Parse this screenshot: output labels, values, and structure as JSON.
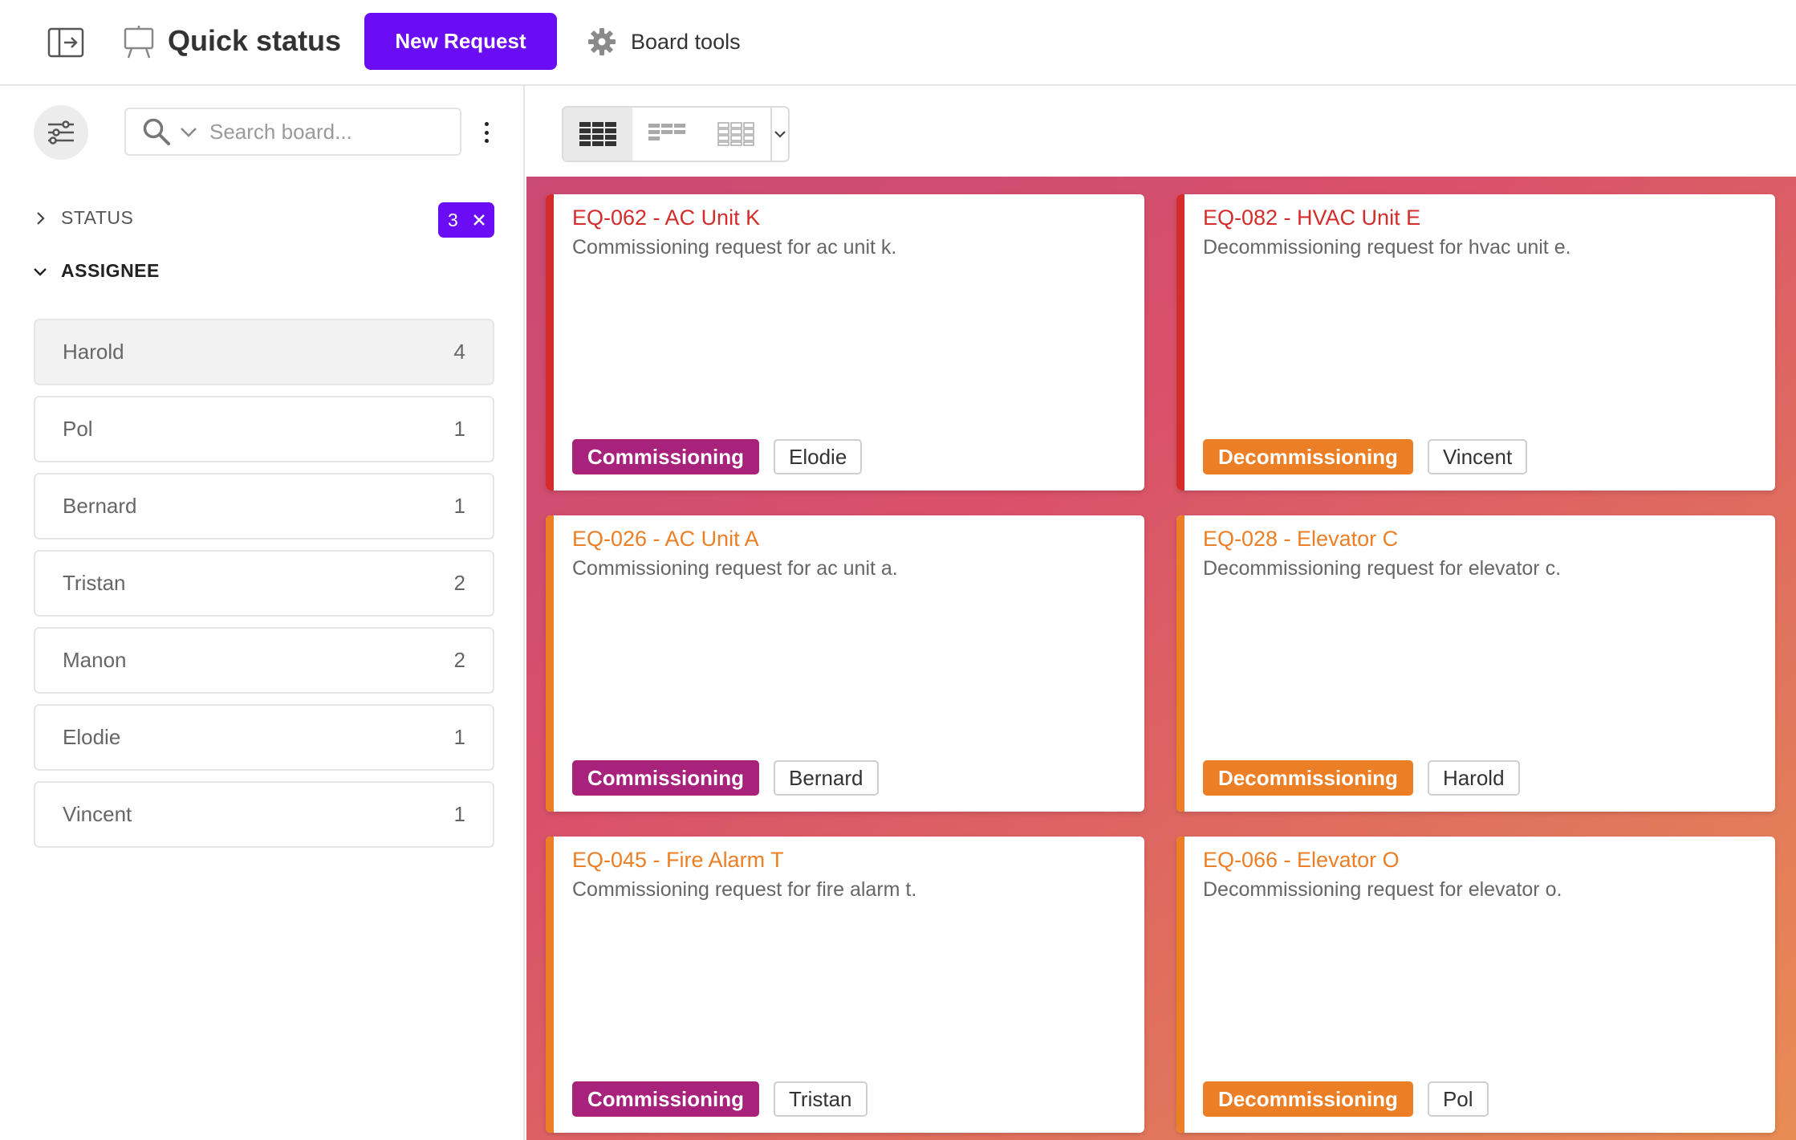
{
  "header": {
    "title": "Quick status",
    "new_request_label": "New Request",
    "board_tools_label": "Board tools",
    "icons": {
      "toggle": "sidebar-toggle-icon",
      "board": "board-easel-icon",
      "tools": "gear-icon"
    }
  },
  "sidebar": {
    "search_placeholder": "Search board...",
    "sections": {
      "status": {
        "label": "STATUS",
        "badge_count": "3",
        "expanded": false
      },
      "assignee": {
        "label": "ASSIGNEE",
        "expanded": true
      }
    },
    "assignees": [
      {
        "name": "Harold",
        "count": "4",
        "active": true
      },
      {
        "name": "Pol",
        "count": "1"
      },
      {
        "name": "Bernard",
        "count": "1"
      },
      {
        "name": "Tristan",
        "count": "2"
      },
      {
        "name": "Manon",
        "count": "2"
      },
      {
        "name": "Elodie",
        "count": "1"
      },
      {
        "name": "Vincent",
        "count": "1"
      }
    ]
  },
  "colors": {
    "accent": "#6a0df4",
    "commissioning_tag": "#a8217a",
    "decommissioning_tag": "#ec7f26",
    "red_title": "#d42b2b",
    "orange_title": "#ec7f26"
  },
  "cards": [
    {
      "title": "EQ-062 - AC Unit K",
      "description": "Commissioning request for ac unit k.",
      "type": "Commissioning",
      "assignee": "Elodie",
      "accent": "red"
    },
    {
      "title": "EQ-082 - HVAC Unit E",
      "description": "Decommissioning request for hvac unit e.",
      "type": "Decommissioning",
      "assignee": "Vincent",
      "accent": "red"
    },
    {
      "title": "EQ-026 - AC Unit A",
      "description": "Commissioning request for ac unit a.",
      "type": "Commissioning",
      "assignee": "Bernard",
      "accent": "orange"
    },
    {
      "title": "EQ-028 - Elevator C",
      "description": "Decommissioning request for elevator c.",
      "type": "Decommissioning",
      "assignee": "Harold",
      "accent": "orange"
    },
    {
      "title": "EQ-045 - Fire Alarm T",
      "description": "Commissioning request for fire alarm t.",
      "type": "Commissioning",
      "assignee": "Tristan",
      "accent": "orange"
    },
    {
      "title": "EQ-066 - Elevator O",
      "description": "Decommissioning request for elevator o.",
      "type": "Decommissioning",
      "assignee": "Pol",
      "accent": "orange"
    }
  ]
}
